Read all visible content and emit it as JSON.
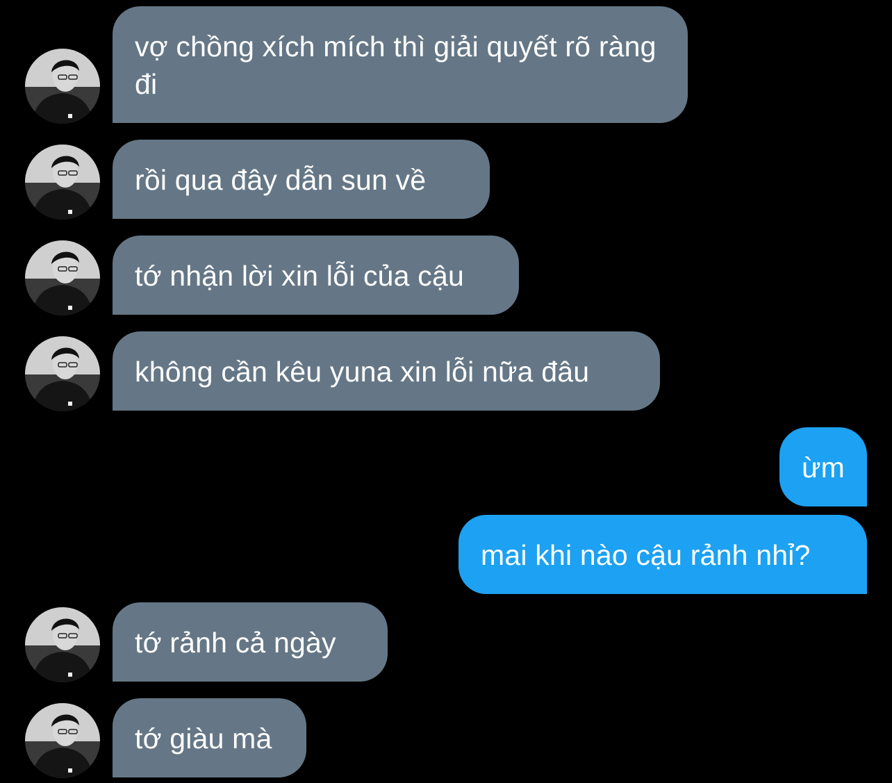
{
  "colors": {
    "background": "#000000",
    "incoming_bubble": "#657786",
    "outgoing_bubble": "#1da1f2",
    "text": "#ffffff"
  },
  "avatar_icon": "user-avatar-icon",
  "messages": [
    {
      "direction": "incoming",
      "text": "vợ chồng xích mích thì giải quyết rõ ràng đi"
    },
    {
      "direction": "incoming",
      "text": "rồi qua đây dẫn sun về"
    },
    {
      "direction": "incoming",
      "text": "tớ nhận lời xin lỗi của cậu"
    },
    {
      "direction": "incoming",
      "text": "không cần kêu yuna xin lỗi nữa đâu"
    },
    {
      "direction": "outgoing",
      "text": "ừm"
    },
    {
      "direction": "outgoing",
      "text": "mai khi nào cậu rảnh nhỉ?"
    },
    {
      "direction": "incoming",
      "text": "tớ rảnh cả ngày"
    },
    {
      "direction": "incoming",
      "text": "tớ giàu mà"
    }
  ]
}
